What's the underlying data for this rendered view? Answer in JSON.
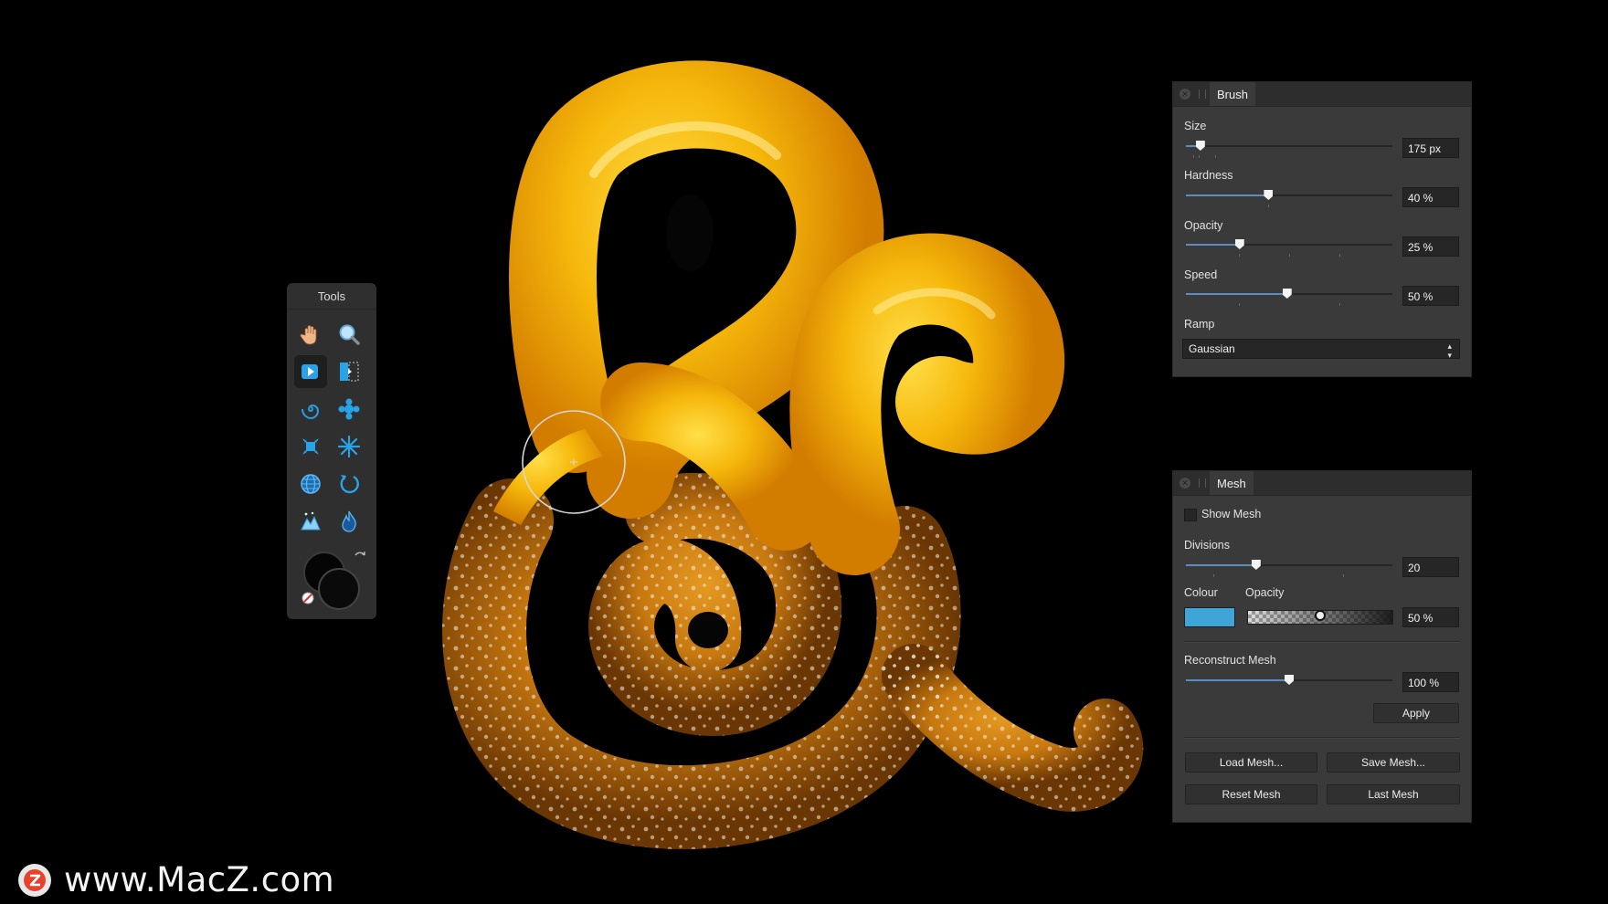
{
  "tools_panel": {
    "title": "Tools",
    "tools": [
      {
        "icon": "hand-icon"
      },
      {
        "icon": "zoom-icon"
      },
      {
        "icon": "push-forward-icon",
        "active": true
      },
      {
        "icon": "push-left-icon"
      },
      {
        "icon": "twirl-icon"
      },
      {
        "icon": "pinch-icon"
      },
      {
        "icon": "punch-icon"
      },
      {
        "icon": "turbulence-icon"
      },
      {
        "icon": "mesh-clone-icon"
      },
      {
        "icon": "reconstruct-icon"
      },
      {
        "icon": "freeze-icon"
      },
      {
        "icon": "thaw-icon"
      }
    ]
  },
  "brush_panel": {
    "tab": "Brush",
    "size": {
      "label": "Size",
      "value": "175 px",
      "fraction": 0.07
    },
    "hardness": {
      "label": "Hardness",
      "value": "40 %",
      "fraction": 0.4
    },
    "opacity": {
      "label": "Opacity",
      "value": "25 %",
      "fraction": 0.26
    },
    "speed": {
      "label": "Speed",
      "value": "50 %",
      "fraction": 0.49
    },
    "ramp": {
      "label": "Ramp",
      "value": "Gaussian"
    }
  },
  "mesh_panel": {
    "tab": "Mesh",
    "show_mesh": {
      "label": "Show Mesh",
      "checked": false
    },
    "divisions": {
      "label": "Divisions",
      "value": "20",
      "fraction": 0.34
    },
    "colour": {
      "label": "Colour",
      "value": "#3fa5d8"
    },
    "opacity": {
      "label": "Opacity",
      "value": "50 %",
      "fraction": 0.5
    },
    "reconstruct": {
      "label": "Reconstruct Mesh",
      "value": "100 %",
      "fraction": 0.5
    },
    "apply_label": "Apply",
    "load_label": "Load Mesh...",
    "save_label": "Save Mesh...",
    "reset_label": "Reset Mesh",
    "last_label": "Last Mesh"
  },
  "watermark": {
    "text": "www.MacZ.com"
  },
  "colors": {
    "accent": "#3fa5d8",
    "slider_fill": "#5c8cc0",
    "cheese": "#f5b70d",
    "pretzel": "#c77a12"
  }
}
